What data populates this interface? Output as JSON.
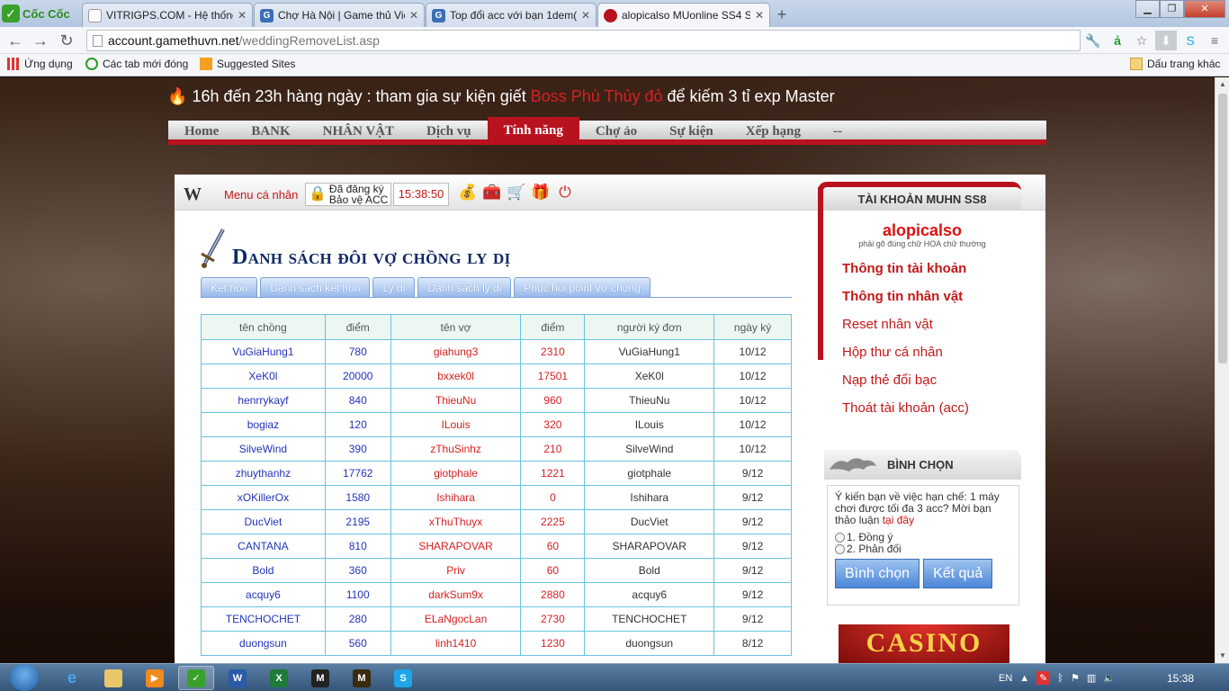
{
  "browser": {
    "logo": "Cốc Cốc",
    "tabs": [
      {
        "title": "VITRIGPS.COM - Hệ thống",
        "favicon": "doc",
        "color": "#888888"
      },
      {
        "title": "Chợ Hà Nội | Game thủ Việ",
        "favicon": "G",
        "color": "#3b6fb6"
      },
      {
        "title": "Top đổi acc với bạn 1dem(",
        "favicon": "G",
        "color": "#3b6fb6"
      },
      {
        "title": "alopicalso MUonline SS4 S",
        "favicon": "mu",
        "color": "#b8121e"
      }
    ],
    "url_host": "account.gamethuvn.net",
    "url_path": "/weddingRemoveList.asp",
    "bookmarks": {
      "apps": "Ứng dụng",
      "recent": "Các tab mới đóng",
      "suggested": "Suggested Sites",
      "other": "Dấu trang khác"
    }
  },
  "page": {
    "notice_pre": "16h đến 23h hàng ngày : tham gia sự kiện giết ",
    "notice_boss": "Boss Phù Thủy đỏ",
    "notice_post": " để kiếm 3 tỉ exp Master",
    "nav": [
      "Home",
      "BANK",
      "NHÂN VẬT",
      "Dịch vụ",
      "Tính năng",
      "Chợ ảo",
      "Sự kiện",
      "Xếp hạng",
      "--"
    ],
    "nav_active": 4,
    "menu_label": "Menu cá nhân",
    "reg_line1": "Đã đăng ký",
    "reg_line2": "Bảo vệ ACC",
    "clock": "15:38:50",
    "title": "Danh sách đôi vợ chồng ly dị",
    "tabs": [
      "Kết hôn",
      "Danh sách kết hôn",
      "Ly dị",
      "Danh sách ly dị",
      "Phục hồi point vợ chồng"
    ],
    "table_headers": [
      "tên chồng",
      "điểm",
      "tên vợ",
      "điểm",
      "người ký đơn",
      "ngày ký"
    ],
    "rows": [
      [
        "VuGiaHung1",
        "780",
        "giahung3",
        "2310",
        "VuGiaHung1",
        "10/12"
      ],
      [
        "XeK0l",
        "20000",
        "bxxek0l",
        "17501",
        "XeK0l",
        "10/12"
      ],
      [
        "henrrykayf",
        "840",
        "ThieuNu",
        "960",
        "ThieuNu",
        "10/12"
      ],
      [
        "bogiaz",
        "120",
        "ILouis",
        "320",
        "ILouis",
        "10/12"
      ],
      [
        "SilveWind",
        "390",
        "zThuSinhz",
        "210",
        "SilveWind",
        "10/12"
      ],
      [
        "zhuythanhz",
        "17762",
        "giotphale",
        "1221",
        "giotphale",
        "9/12"
      ],
      [
        "xOKillerOx",
        "1580",
        "Ishihara",
        "0",
        "Ishihara",
        "9/12"
      ],
      [
        "DucViet",
        "2195",
        "xThuThuyx",
        "2225",
        "DucViet",
        "9/12"
      ],
      [
        "CANTANA",
        "810",
        "SHARAPOVAR",
        "60",
        "SHARAPOVAR",
        "9/12"
      ],
      [
        "Bold",
        "360",
        "Priv",
        "60",
        "Bold",
        "9/12"
      ],
      [
        "acquy6",
        "1100",
        "darkSum9x",
        "2880",
        "acquy6",
        "9/12"
      ],
      [
        "TENCHOCHET",
        "280",
        "ELaNgocLan",
        "2730",
        "TENCHOCHET",
        "9/12"
      ],
      [
        "duongsun",
        "560",
        "linh1410",
        "1230",
        "duongsun",
        "8/12"
      ]
    ]
  },
  "account": {
    "header": "TÀI KHOẢN MUHN SS8",
    "username": "alopicalso",
    "note": "phải gõ đúng chữ HOA chữ thường",
    "links": [
      "Thông tin tài khoản",
      "Thông tin nhân vật",
      "Reset nhân vật",
      "Hộp thư cá nhân",
      "Nạp thẻ đổi bạc",
      "Thoát tài khoản (acc)"
    ]
  },
  "vote": {
    "header": "BÌNH CHỌN",
    "question": "Ý kiến bạn về việc hạn chế: 1 máy chơi được tối đa 3 acc? Mời bạn thảo luận ",
    "question_link": "tại đây",
    "option1": "1. Đồng ý",
    "option2": "2. Phản đối",
    "vote_btn": "Bình chọn",
    "result_btn": "Kết quả"
  },
  "banner": "CASINO",
  "taskbar": {
    "lang": "EN",
    "time": "15:38"
  },
  "colors": {
    "brand_red": "#b8121e",
    "link_red": "#c41818",
    "table_border": "#67c4e0",
    "title_blue": "#102a66"
  }
}
